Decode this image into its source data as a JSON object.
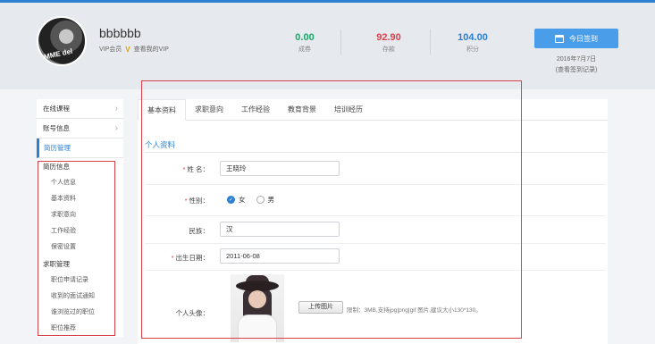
{
  "profile": {
    "username": "bbbbbb",
    "vip_label": "VIP会员",
    "vip_badge": "V",
    "vip_link": "查看我的VIP",
    "avatar_text": "MME del"
  },
  "stats": [
    {
      "value": "0.00",
      "label": "成券",
      "color": "#1aa86a"
    },
    {
      "value": "92.90",
      "label": "存款",
      "color": "#d9414a"
    },
    {
      "value": "104.00",
      "label": "积分",
      "color": "#2d7fd2"
    }
  ],
  "checkin": {
    "button_label": "今日签到",
    "date": "2016年7月7日",
    "record_link": "(查看签到记录)"
  },
  "sidebar": {
    "items": [
      {
        "label": "在线课程",
        "chevron": "›"
      },
      {
        "label": "账号信息",
        "chevron": "›"
      },
      {
        "label": "简历管理"
      }
    ],
    "groups": [
      {
        "title": "简历信息",
        "links": [
          "个人信息",
          "基本资料",
          "求职意向",
          "工作经验",
          "保密设置"
        ]
      },
      {
        "title": "求职管理",
        "links": [
          "职位申请记录",
          "收到的面试通知",
          "谁浏览过的职位",
          "职位推荐"
        ]
      }
    ]
  },
  "tabs": [
    "基本资料",
    "求职意向",
    "工作经验",
    "教育背景",
    "培训经历"
  ],
  "form": {
    "section_title": "个人资料",
    "name_label": "姓 名：",
    "name_value": "王晓玲",
    "gender_label": "性别：",
    "gender_female": "女",
    "gender_male": "男",
    "gender_check": "✓",
    "ethnicity_label": "民族：",
    "ethnicity_value": "汉",
    "birthday_label": "出生日期：",
    "birthday_value": "2011-06-08",
    "photo_label": "个人头像：",
    "upload_button": "上传图片",
    "upload_hint": "限制：3MB,支持jpg|png|gif 图片,建议大小130*130。",
    "required_mark": "*"
  },
  "colors": {
    "accent": "#2d7fd2",
    "highlight_box": "#d9414a"
  }
}
